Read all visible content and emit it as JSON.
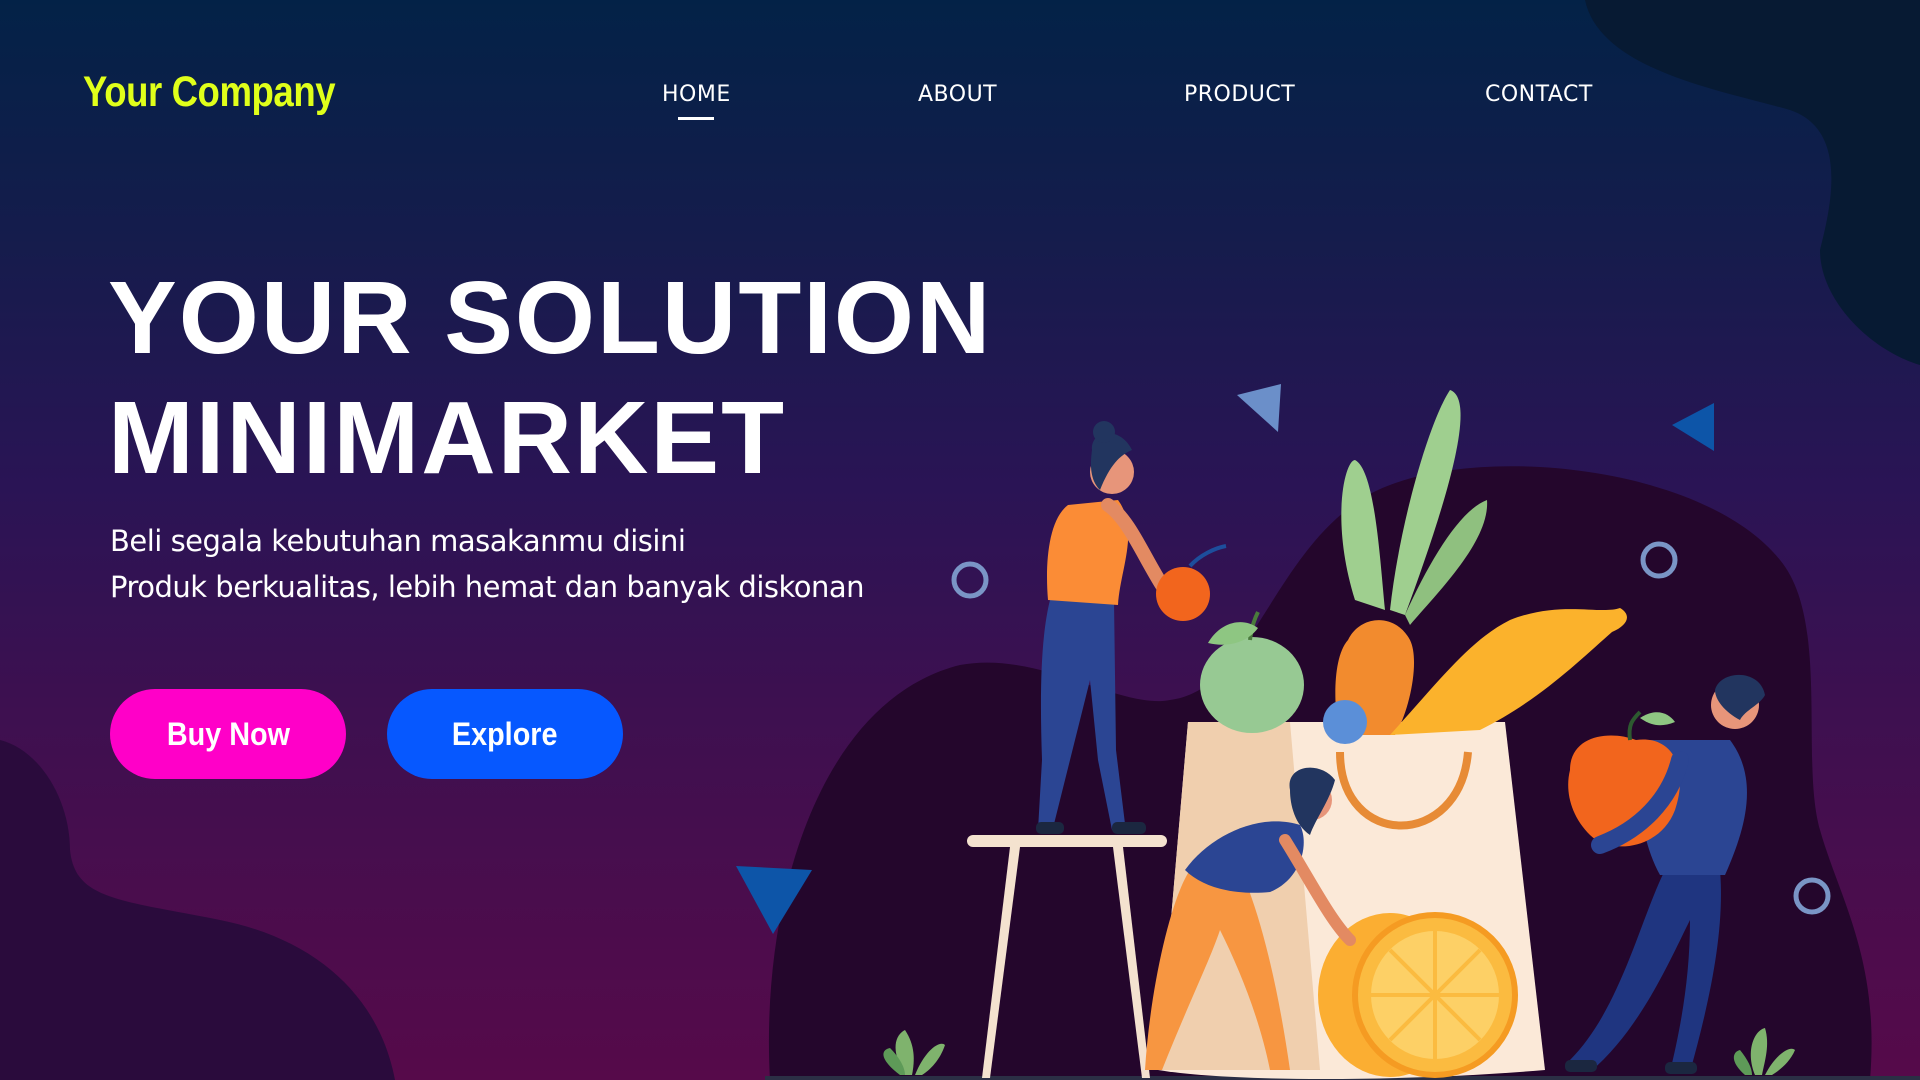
{
  "brand": {
    "name": "Your Company",
    "color": "#e0ff1a"
  },
  "nav": {
    "items": [
      {
        "label": "HOME",
        "active": true
      },
      {
        "label": "ABOUT",
        "active": false
      },
      {
        "label": "PRODUCT",
        "active": false
      },
      {
        "label": "CONTACT",
        "active": false
      }
    ]
  },
  "hero": {
    "title_line1": "YOUR SOLUTION",
    "title_line2": "MINIMARKET",
    "subtitle_line1": "Beli segala kebutuhan masakanmu disini",
    "subtitle_line2": "Produk berkualitas, lebih hemat dan banyak diskonan"
  },
  "buttons": {
    "buy_now": {
      "label": "Buy Now",
      "color": "#ff00c8"
    },
    "explore": {
      "label": "Explore",
      "color": "#0658ff"
    }
  },
  "illustration": {
    "icons": [
      "woman-on-stool-icon",
      "apple-icon",
      "grocery-bag-icon",
      "carrot-icon",
      "banana-icon",
      "orange-slice-icon",
      "woman-pushing-orange-icon",
      "man-carrying-apple-icon",
      "plant-icon"
    ]
  }
}
